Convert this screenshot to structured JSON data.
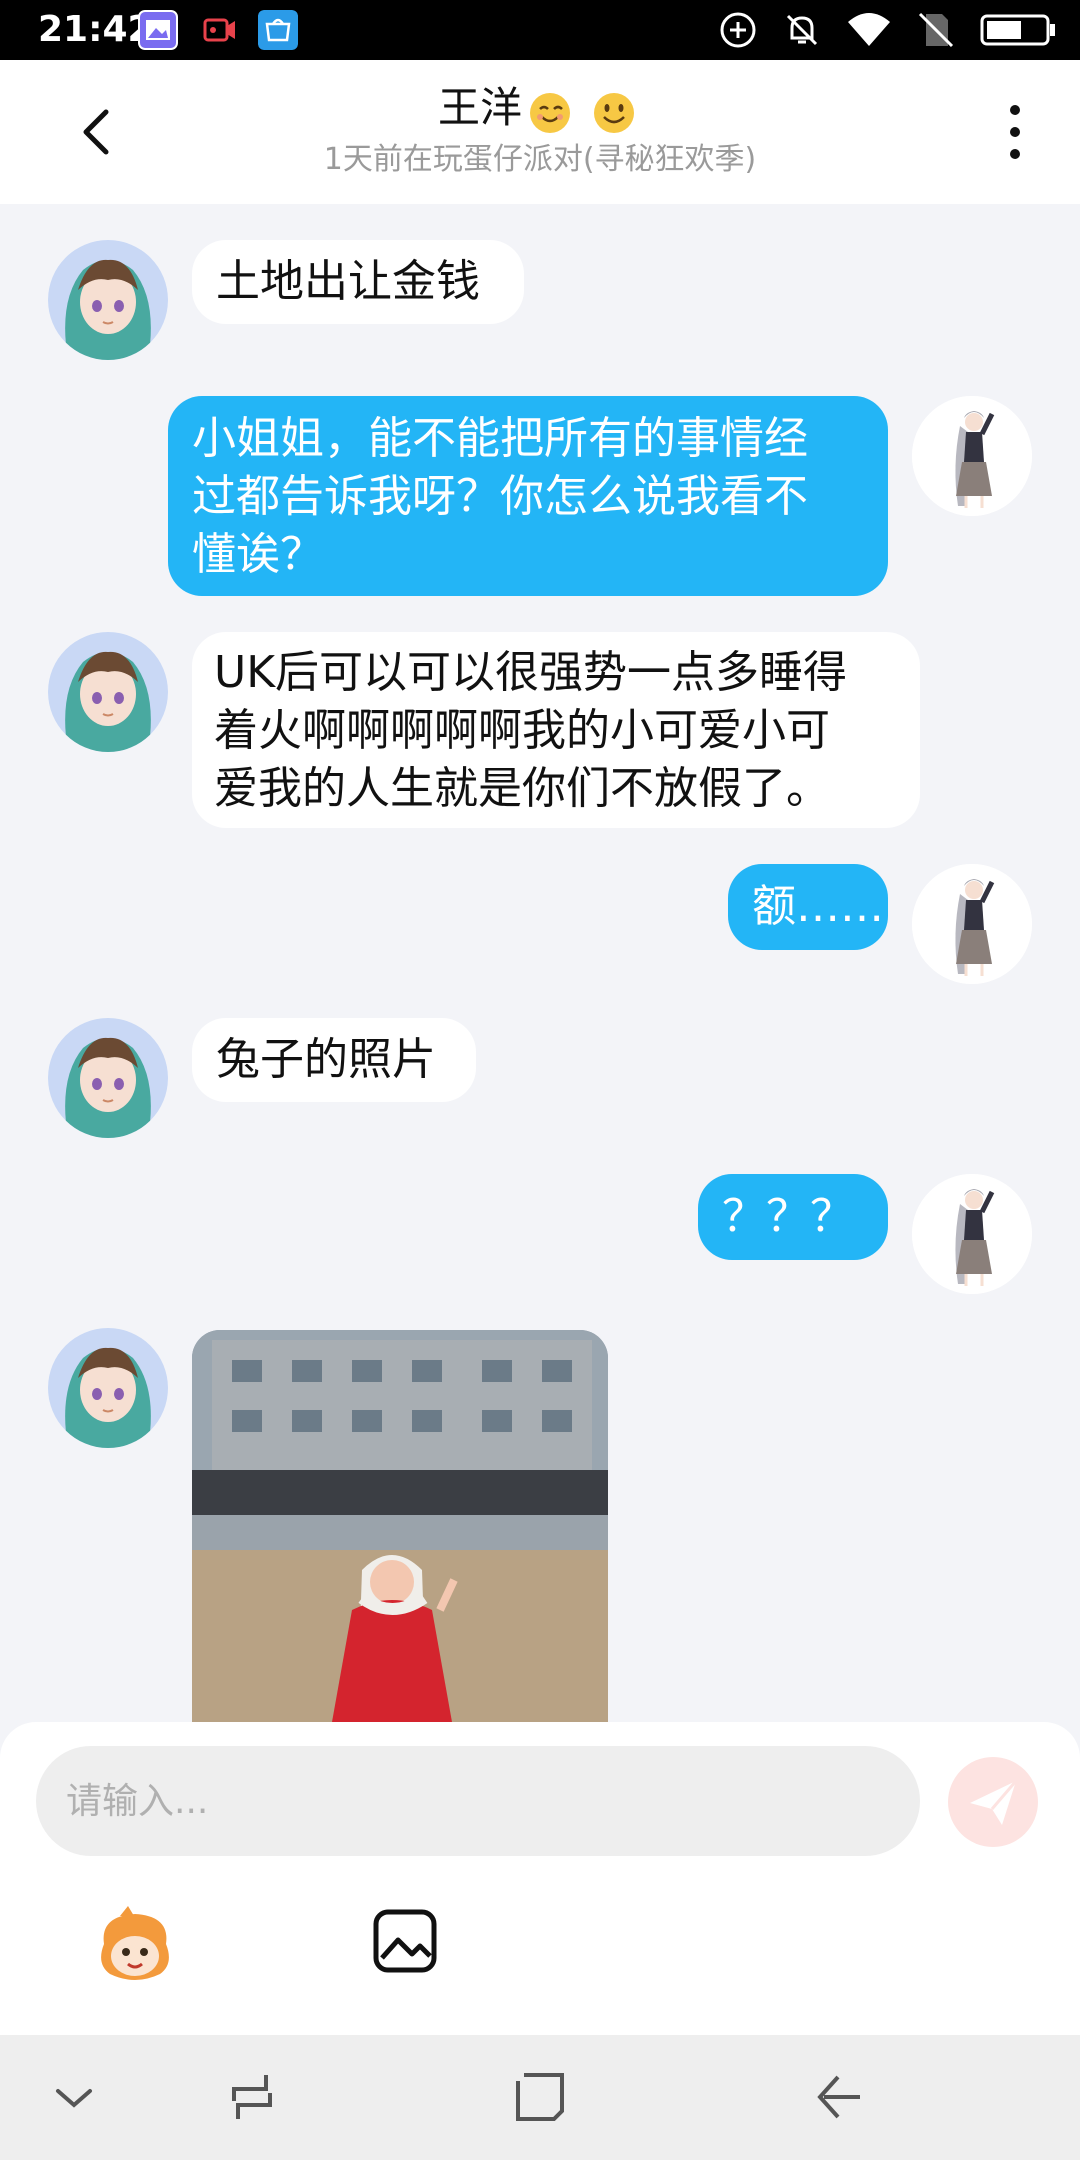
{
  "status_bar": {
    "time": "21:42",
    "icons": [
      "gallery-icon",
      "screen-record-icon",
      "koobee-store-icon",
      "add-circle-icon",
      "bell-off-icon",
      "wifi-icon",
      "no-sim-icon",
      "battery-icon"
    ]
  },
  "header": {
    "title": "王洋",
    "subtitle": "1天前在玩蛋仔派对(寻秘狂欢季)"
  },
  "messages": [
    {
      "side": "in",
      "lines": [
        "土地出让金钱"
      ]
    },
    {
      "side": "out",
      "lines": [
        "小姐姐，能不能把所有的事情经",
        "过都告诉我呀？你怎么说我看不",
        "懂诶？"
      ]
    },
    {
      "side": "in",
      "lines": [
        "UK后可以可以很强势一点多睡得",
        "着火啊啊啊啊啊我的小可爱小可",
        "爱我的人生就是你们不放假了。"
      ]
    },
    {
      "side": "out",
      "lines": [
        "额……"
      ]
    },
    {
      "side": "in",
      "lines": [
        "兔子的照片"
      ]
    },
    {
      "side": "out",
      "lines": [
        "？？？"
      ]
    },
    {
      "side": "in",
      "type": "image",
      "description_icon": "photo-message"
    }
  ],
  "composer": {
    "placeholder": "请输入...",
    "value": ""
  },
  "colors": {
    "accent": "#23b5f6",
    "send_button": "#fde3e1",
    "background": "#f3f4f8"
  },
  "navbar": {
    "icons": [
      "chevron-down-icon",
      "recent-apps-icon",
      "home-icon",
      "back-icon"
    ]
  }
}
